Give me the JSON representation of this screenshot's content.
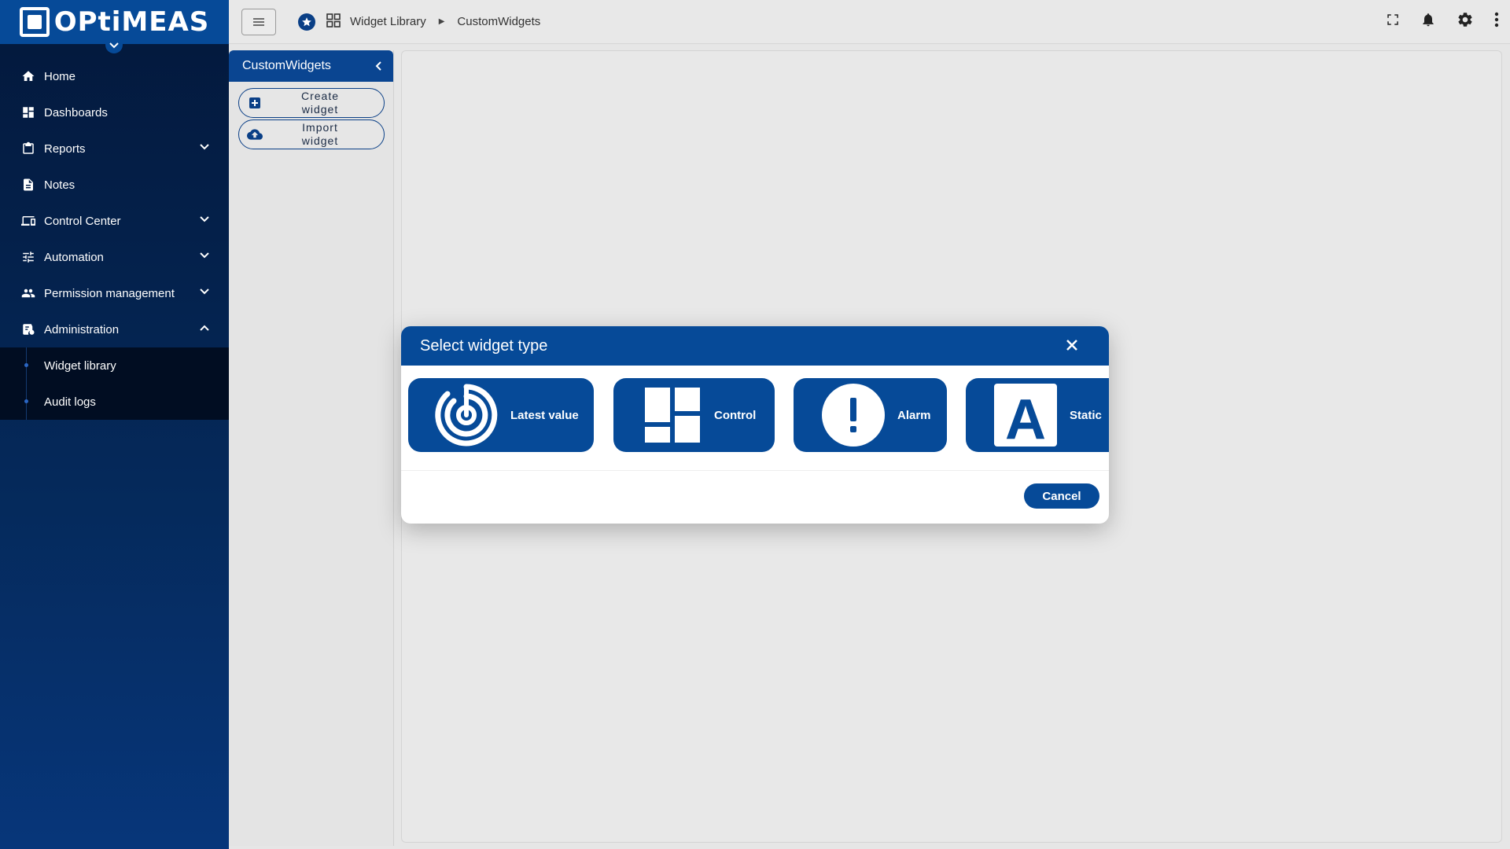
{
  "brand": {
    "name": "OPtiMEAS"
  },
  "sidebar": {
    "items": [
      {
        "label": "Home",
        "icon": "home-icon",
        "expandable": false
      },
      {
        "label": "Dashboards",
        "icon": "dashboard-icon",
        "expandable": false
      },
      {
        "label": "Reports",
        "icon": "clipboard-icon",
        "expandable": true
      },
      {
        "label": "Notes",
        "icon": "document-icon",
        "expandable": false
      },
      {
        "label": "Control Center",
        "icon": "devices-icon",
        "expandable": true
      },
      {
        "label": "Automation",
        "icon": "sliders-icon",
        "expandable": true
      },
      {
        "label": "Permission management",
        "icon": "people-icon",
        "expandable": true
      },
      {
        "label": "Administration",
        "icon": "admin-icon",
        "expandable": true,
        "expanded": true
      }
    ],
    "subitems": [
      {
        "label": "Widget library"
      },
      {
        "label": "Audit logs"
      }
    ]
  },
  "topbar": {
    "breadcrumb": [
      "Widget Library",
      "CustomWidgets"
    ],
    "icons": [
      "fullscreen-icon",
      "bell-icon",
      "gear-icon",
      "more-vert-icon"
    ]
  },
  "panel": {
    "title": "CustomWidgets",
    "create_label": "Create\nwidget",
    "import_label": "Import\nwidget"
  },
  "modal": {
    "title": "Select widget type",
    "cards": [
      {
        "label": "Latest value",
        "icon": "latest-value-icon"
      },
      {
        "label": "Control",
        "icon": "control-icon"
      },
      {
        "label": "Alarm",
        "icon": "alarm-icon"
      },
      {
        "label": "Static",
        "icon": "static-icon"
      }
    ],
    "cancel_label": "Cancel"
  },
  "colors": {
    "primary": "#064a98",
    "sidebar_dark": "#03183b",
    "background": "#e8e8e8"
  }
}
